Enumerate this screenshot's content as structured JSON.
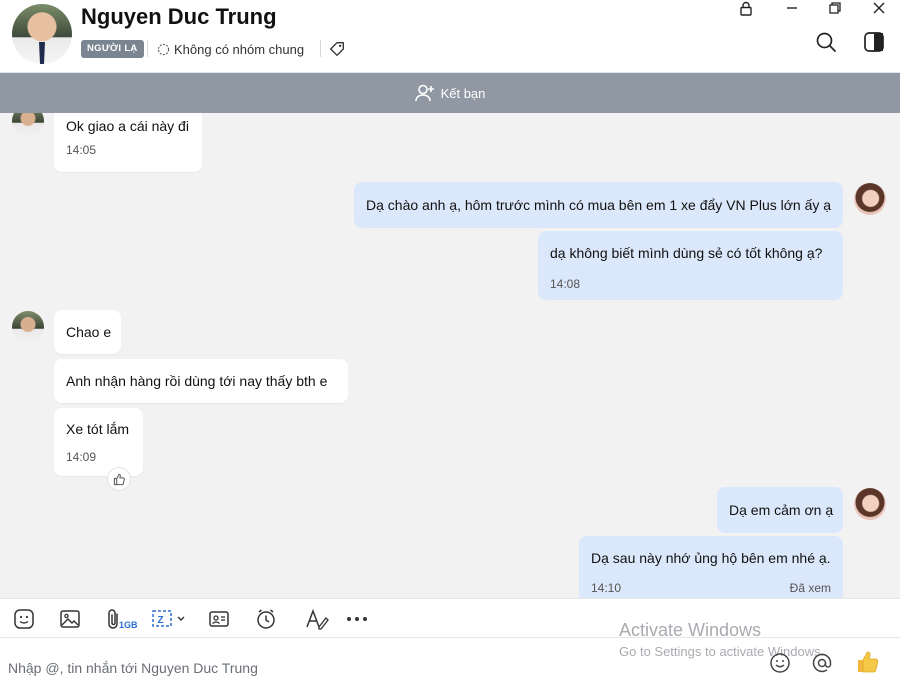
{
  "header": {
    "contact_name": "Nguyen Duc Trung",
    "badge": "NGƯỜI LẠ",
    "mutual_groups": "Không có nhóm chung"
  },
  "friend_bar": {
    "label": "Kết bạn"
  },
  "messages": [
    {
      "side": "in",
      "text": "Ok giao a cái này đi",
      "time": "14:05"
    },
    {
      "side": "out",
      "text": "Dạ chào anh ạ, hôm trước mình có mua bên em 1 xe đẩy VN Plus lớn ấy ạ",
      "time": ""
    },
    {
      "side": "out",
      "text": "dạ không biết mình dùng sẻ có tốt không ạ?",
      "time": "14:08"
    },
    {
      "side": "in",
      "text": "Chao e",
      "time": ""
    },
    {
      "side": "in",
      "text": "Anh nhận hàng rồi dùng tới nay thấy bth e",
      "time": ""
    },
    {
      "side": "in",
      "text": "Xe tót lắm",
      "time": "14:09"
    },
    {
      "side": "out",
      "text": "Dạ em cảm ơn ạ",
      "time": ""
    },
    {
      "side": "out",
      "text": "Dạ sau này nhớ ủng hộ bên em nhé ạ.",
      "time": "14:10",
      "status": "Đã xem"
    }
  ],
  "toolbar": {
    "file_size_limit": "1GB"
  },
  "composer": {
    "placeholder": "Nhập @, tin nhắn tới Nguyen Duc Trung"
  },
  "watermark": {
    "title": "Activate Windows",
    "subtitle": "Go to Settings to activate Windows."
  },
  "icons": {
    "lock": "lock-icon",
    "minimize": "minimize-icon",
    "restore": "restore-icon",
    "close": "close-icon",
    "search": "search-icon",
    "sidebar": "sidebar-toggle-icon",
    "tag": "tag-icon",
    "group": "group-icon",
    "add_friend": "add-friend-icon",
    "like": "thumbs-up-icon"
  },
  "colors": {
    "outgoing_bubble": "#dbe8fb",
    "incoming_bubble": "#ffffff",
    "friend_bar": "#8f98a3",
    "chat_bg": "#f2f2f2"
  }
}
